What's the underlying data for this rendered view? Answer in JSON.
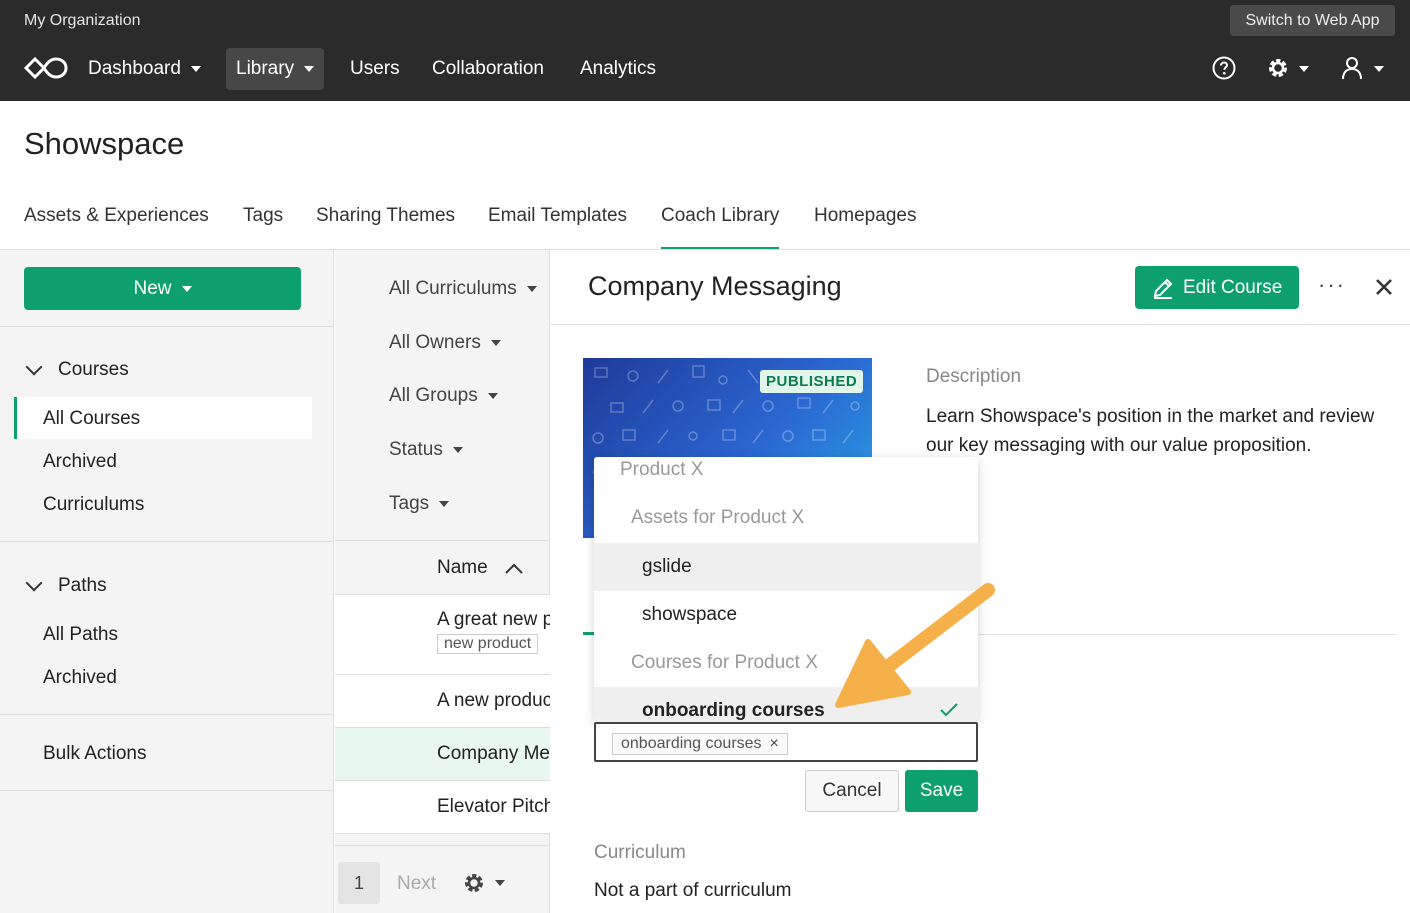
{
  "org": {
    "name": "My Organization",
    "switch_label": "Switch to Web App"
  },
  "nav": {
    "dashboard": "Dashboard",
    "library": "Library",
    "users": "Users",
    "collaboration": "Collaboration",
    "analytics": "Analytics"
  },
  "page": {
    "title": "Showspace",
    "tabs": [
      "Assets & Experiences",
      "Tags",
      "Sharing Themes",
      "Email Templates",
      "Coach Library",
      "Homepages"
    ],
    "active_tab": "Coach Library"
  },
  "sidebar": {
    "new_label": "New",
    "courses_heading": "Courses",
    "courses_items": [
      "All Courses",
      "Archived",
      "Curriculums"
    ],
    "paths_heading": "Paths",
    "paths_items": [
      "All Paths",
      "Archived"
    ],
    "bulk_actions": "Bulk Actions"
  },
  "list": {
    "filters": [
      "All Curriculums",
      "All Owners",
      "All Groups",
      "Status",
      "Tags"
    ],
    "name_header": "Name",
    "rows": [
      {
        "name": "A great new p",
        "tag": "new product"
      },
      {
        "name": "A new produc"
      },
      {
        "name": "Company Me"
      },
      {
        "name": "Elevator Pitch"
      }
    ],
    "pager": {
      "page": "1",
      "next": "Next"
    }
  },
  "detail": {
    "title": "Company Messaging",
    "edit_label": "Edit Course",
    "more_label": "···",
    "status_badge": "PUBLISHED",
    "description_label": "Description",
    "description": "Learn Showspace's position in the market and review our key messaging with our value proposition.",
    "curriculum_label": "Curriculum",
    "curriculum_value": "Not a part of curriculum"
  },
  "dropdown": {
    "group_top": "Product X",
    "group_assets": "Assets for Product X",
    "opt_gslide": "gslide",
    "opt_showspace": "showspace",
    "group_courses": "Courses for Product X",
    "opt_onboarding": "onboarding courses",
    "selected_tag": "onboarding courses"
  },
  "actions": {
    "cancel": "Cancel",
    "save": "Save"
  },
  "colors": {
    "brand_green": "#0e9f6e",
    "topbar": "#2b2b2b",
    "annotation_arrow": "#f5b04a"
  }
}
